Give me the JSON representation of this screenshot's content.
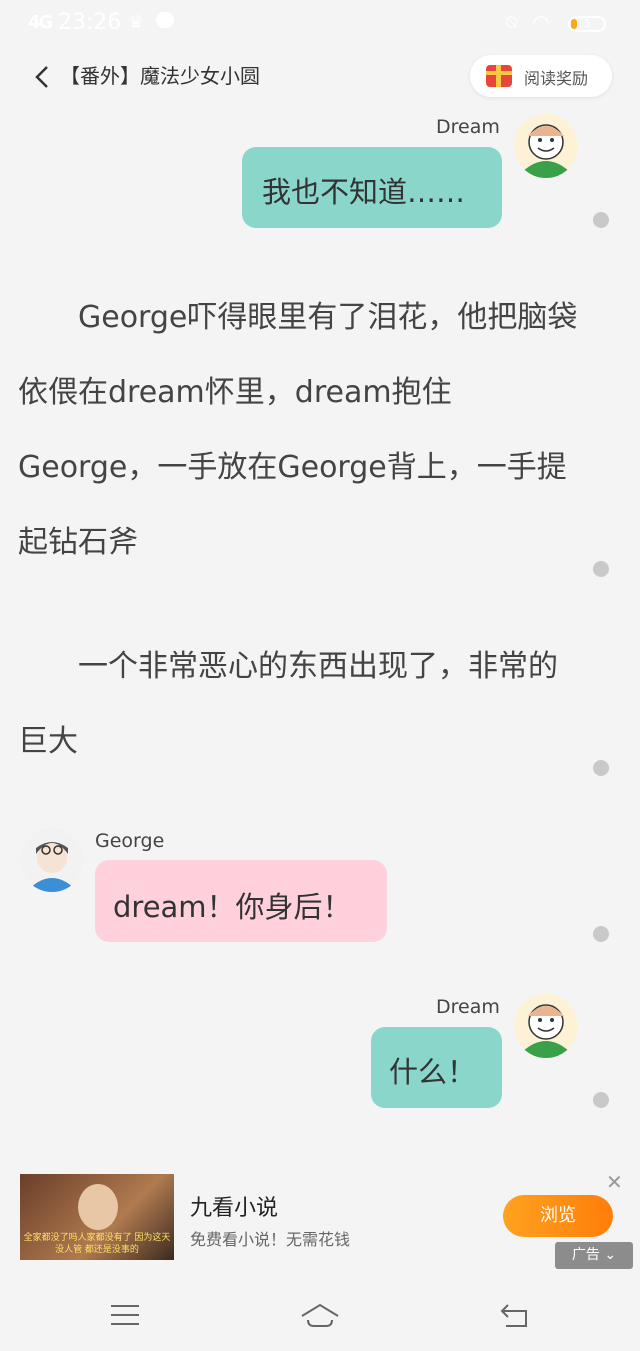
{
  "status_bar": {
    "time": "23:26",
    "battery": "5"
  },
  "header": {
    "title": "【番外】魔法少女小圆",
    "reward_label": "阅读奖励"
  },
  "messages": [
    {
      "speaker": "Dream",
      "text": "我也不知道……"
    },
    {
      "speaker": "George",
      "text": "dream！你身后！"
    },
    {
      "speaker": "Dream",
      "text": "什么！"
    }
  ],
  "paragraphs": [
    "　　George吓得眼里有了泪花，他把脑袋依偎在dream怀里，dream抱住George，一手放在George背上，一手提起钻石斧",
    "　　一个非常恶心的东西出现了，非常的巨大"
  ],
  "ad": {
    "title": "九看小说",
    "description": "免费看小说！无需花钱",
    "button": "浏览",
    "tag": "广告",
    "thumb_caption": "全家都没了吗人家都没有了 因为这天没人管 都还是没事的"
  },
  "colors": {
    "dream_bubble": "#8ad6cb",
    "george_bubble": "#ffd1dc",
    "ad_button": "#ff8c12"
  }
}
